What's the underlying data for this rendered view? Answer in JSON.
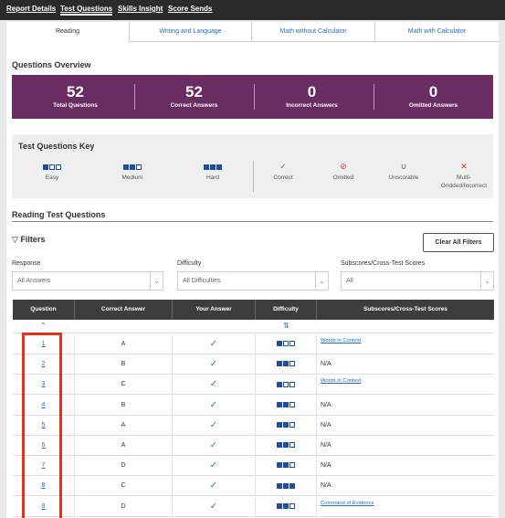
{
  "topnav": [
    {
      "label": "Report Details",
      "active": false
    },
    {
      "label": "Test Questions",
      "active": true
    },
    {
      "label": "Skills Insight",
      "active": false
    },
    {
      "label": "Score Sends",
      "active": false
    }
  ],
  "tabs": [
    {
      "label": "Reading",
      "active": true
    },
    {
      "label": "Writing and Language",
      "active": false
    },
    {
      "label": "Math without Calculator",
      "active": false
    },
    {
      "label": "Math with Calculator",
      "active": false
    }
  ],
  "overview": {
    "title": "Questions Overview",
    "items": [
      {
        "value": "52",
        "label": "Total Questions"
      },
      {
        "value": "52",
        "label": "Correct Answers"
      },
      {
        "value": "0",
        "label": "Incorrect Answers"
      },
      {
        "value": "0",
        "label": "Omitted Answers"
      }
    ]
  },
  "key": {
    "title": "Test Questions Key",
    "difficulty": [
      {
        "label": "Easy",
        "filled": 1
      },
      {
        "label": "Medium",
        "filled": 2
      },
      {
        "label": "Hard",
        "filled": 3
      }
    ],
    "status": [
      {
        "symbol": "✓",
        "label": "Correct",
        "color": "#2a8a4a"
      },
      {
        "symbol": "⊘",
        "label": "Omitted",
        "color": "#c0392b"
      },
      {
        "symbol": "∪",
        "label": "Unscorable",
        "color": "#555555"
      },
      {
        "symbol": "✕",
        "label": "Multi-Gridded/Incorrect",
        "color": "#c0392b"
      }
    ]
  },
  "section_title": "Reading Test Questions",
  "filters": {
    "title": "Filters",
    "clear_label": "Clear All Filters",
    "response": {
      "label": "Response",
      "value": "All Answers"
    },
    "difficulty": {
      "label": "Difficulty",
      "value": "All Difficulties"
    },
    "subscores": {
      "label": "Subscores/Cross-Test Scores",
      "value": "All"
    }
  },
  "table": {
    "headers": [
      "Question",
      "Correct Answer",
      "Your Answer",
      "Difficulty",
      "Subscores/Cross-Test Scores"
    ],
    "rows": [
      {
        "q": "1",
        "correct": "A",
        "yours": "✓",
        "difficulty": 1,
        "subscore": "Words in Context",
        "sub_link": true
      },
      {
        "q": "2",
        "correct": "B",
        "yours": "✓",
        "difficulty": 2,
        "subscore": "N/A",
        "sub_link": false
      },
      {
        "q": "3",
        "correct": "C",
        "yours": "✓",
        "difficulty": 1,
        "subscore": "Words in Context",
        "sub_link": true
      },
      {
        "q": "4",
        "correct": "B",
        "yours": "✓",
        "difficulty": 2,
        "subscore": "N/A",
        "sub_link": false
      },
      {
        "q": "5",
        "correct": "A",
        "yours": "✓",
        "difficulty": 2,
        "subscore": "N/A",
        "sub_link": false
      },
      {
        "q": "6",
        "correct": "A",
        "yours": "✓",
        "difficulty": 2,
        "subscore": "N/A",
        "sub_link": false
      },
      {
        "q": "7",
        "correct": "D",
        "yours": "✓",
        "difficulty": 2,
        "subscore": "N/A",
        "sub_link": false
      },
      {
        "q": "8",
        "correct": "C",
        "yours": "✓",
        "difficulty": 3,
        "subscore": "N/A",
        "sub_link": false
      },
      {
        "q": "9",
        "correct": "D",
        "yours": "✓",
        "difficulty": 2,
        "subscore": "Command of Evidence",
        "sub_link": true
      }
    ]
  },
  "colors": {
    "overview_bg": "#6b2c63",
    "link": "#1f6dbf",
    "highlight": "#e8311a",
    "difficulty_blue": "#1f4e9c"
  }
}
